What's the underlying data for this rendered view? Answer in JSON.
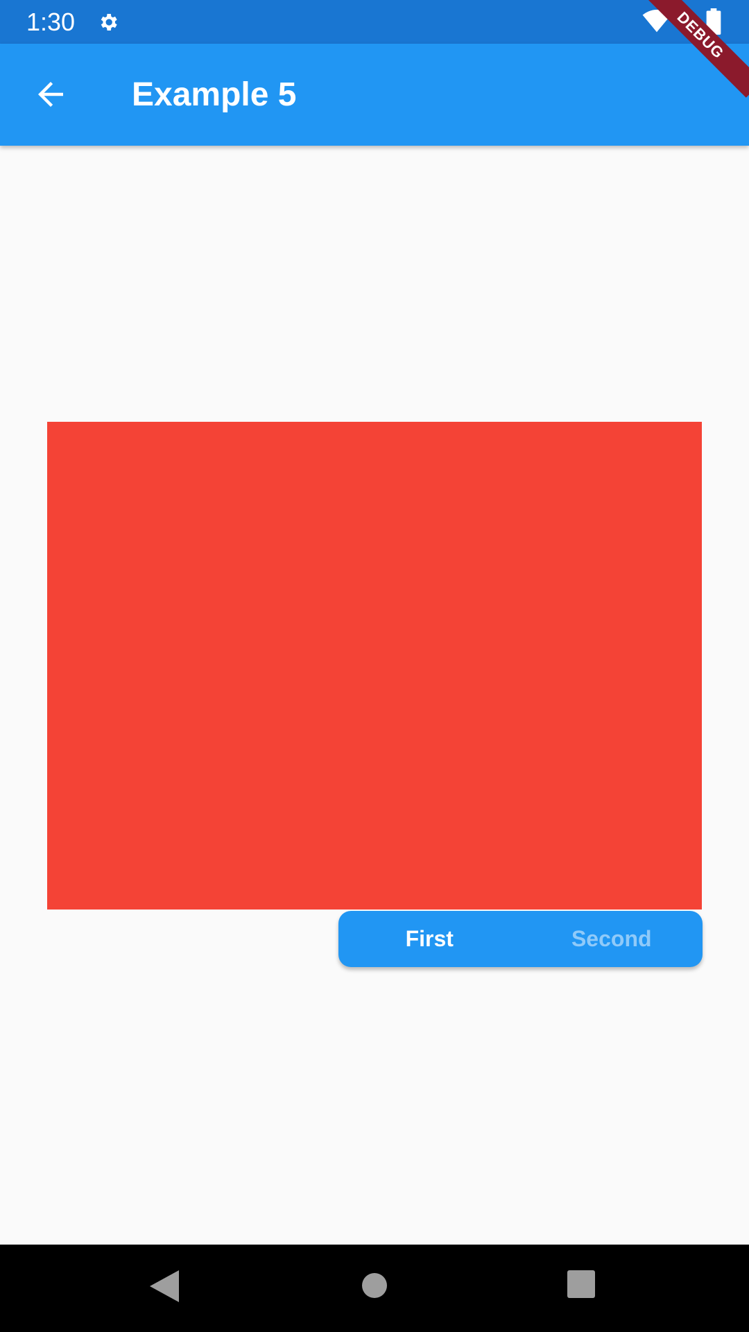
{
  "status_bar": {
    "time": "1:30",
    "icons": [
      "gear-icon",
      "wifi-icon",
      "battery-icon"
    ]
  },
  "app_bar": {
    "title": "Example 5",
    "back_icon": "arrow-back-icon"
  },
  "debug_banner": "DEBUG",
  "content": {
    "box_color": "#f44336",
    "segmented_control": {
      "options": [
        "First",
        "Second"
      ],
      "selected": "First"
    }
  },
  "nav_bar": {
    "icons": [
      "back-triangle-icon",
      "home-circle-icon",
      "recents-square-icon"
    ]
  },
  "colors": {
    "status_bar": "#1976d2",
    "app_bar": "#2196f3",
    "background": "#fafafa",
    "segment_active_text": "#ffffff",
    "segment_inactive_text": "#90caf9"
  }
}
